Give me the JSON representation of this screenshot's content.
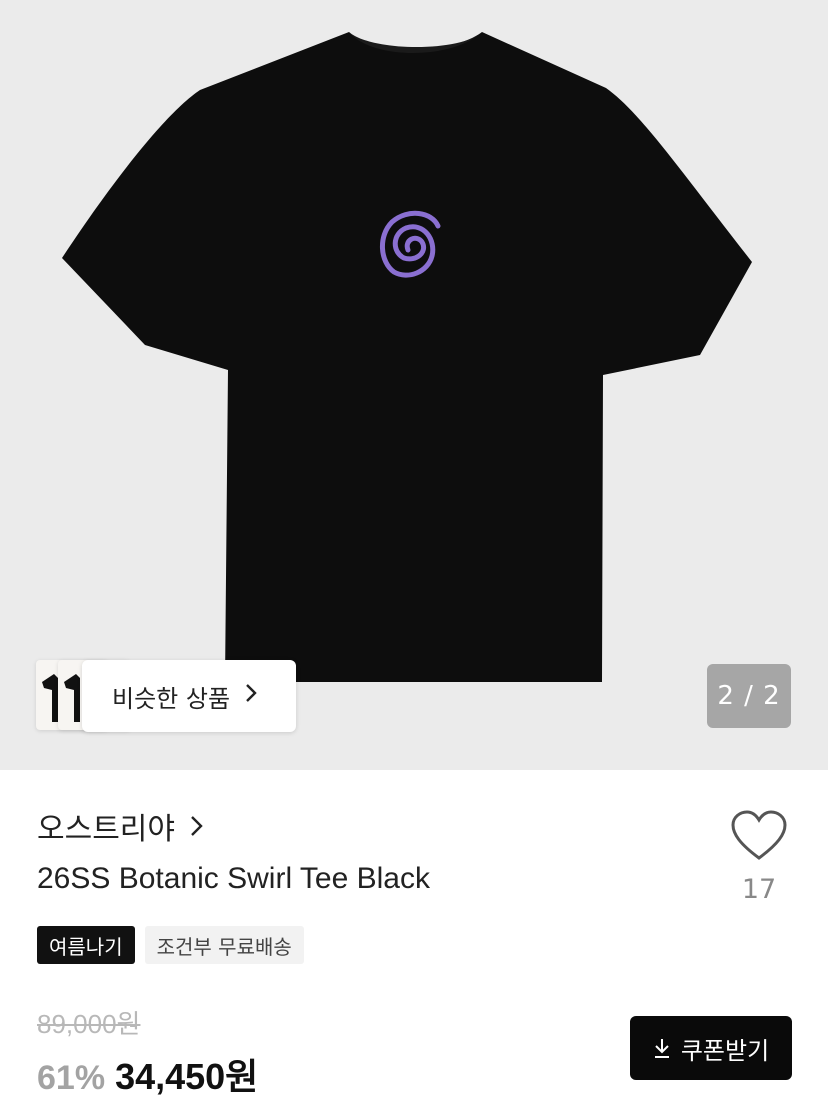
{
  "product_image": {
    "alt": "26SS Botanic Swirl Tee Black",
    "pager": "2 / 2"
  },
  "similar": {
    "label": "비슷한 상품"
  },
  "brand": {
    "name": "오스트리야"
  },
  "product": {
    "title": "26SS Botanic Swirl Tee Black"
  },
  "like": {
    "count": "17"
  },
  "tags": [
    "여름나기",
    "조건부 무료배송"
  ],
  "price": {
    "original": "89,000원",
    "discount": "61%",
    "sale": "34,450원"
  },
  "coupon": {
    "label": "쿠폰받기"
  },
  "colors": {
    "swirl": "#8a6fd1",
    "tee": "#0d0d0d",
    "background": "#ebebeb"
  }
}
